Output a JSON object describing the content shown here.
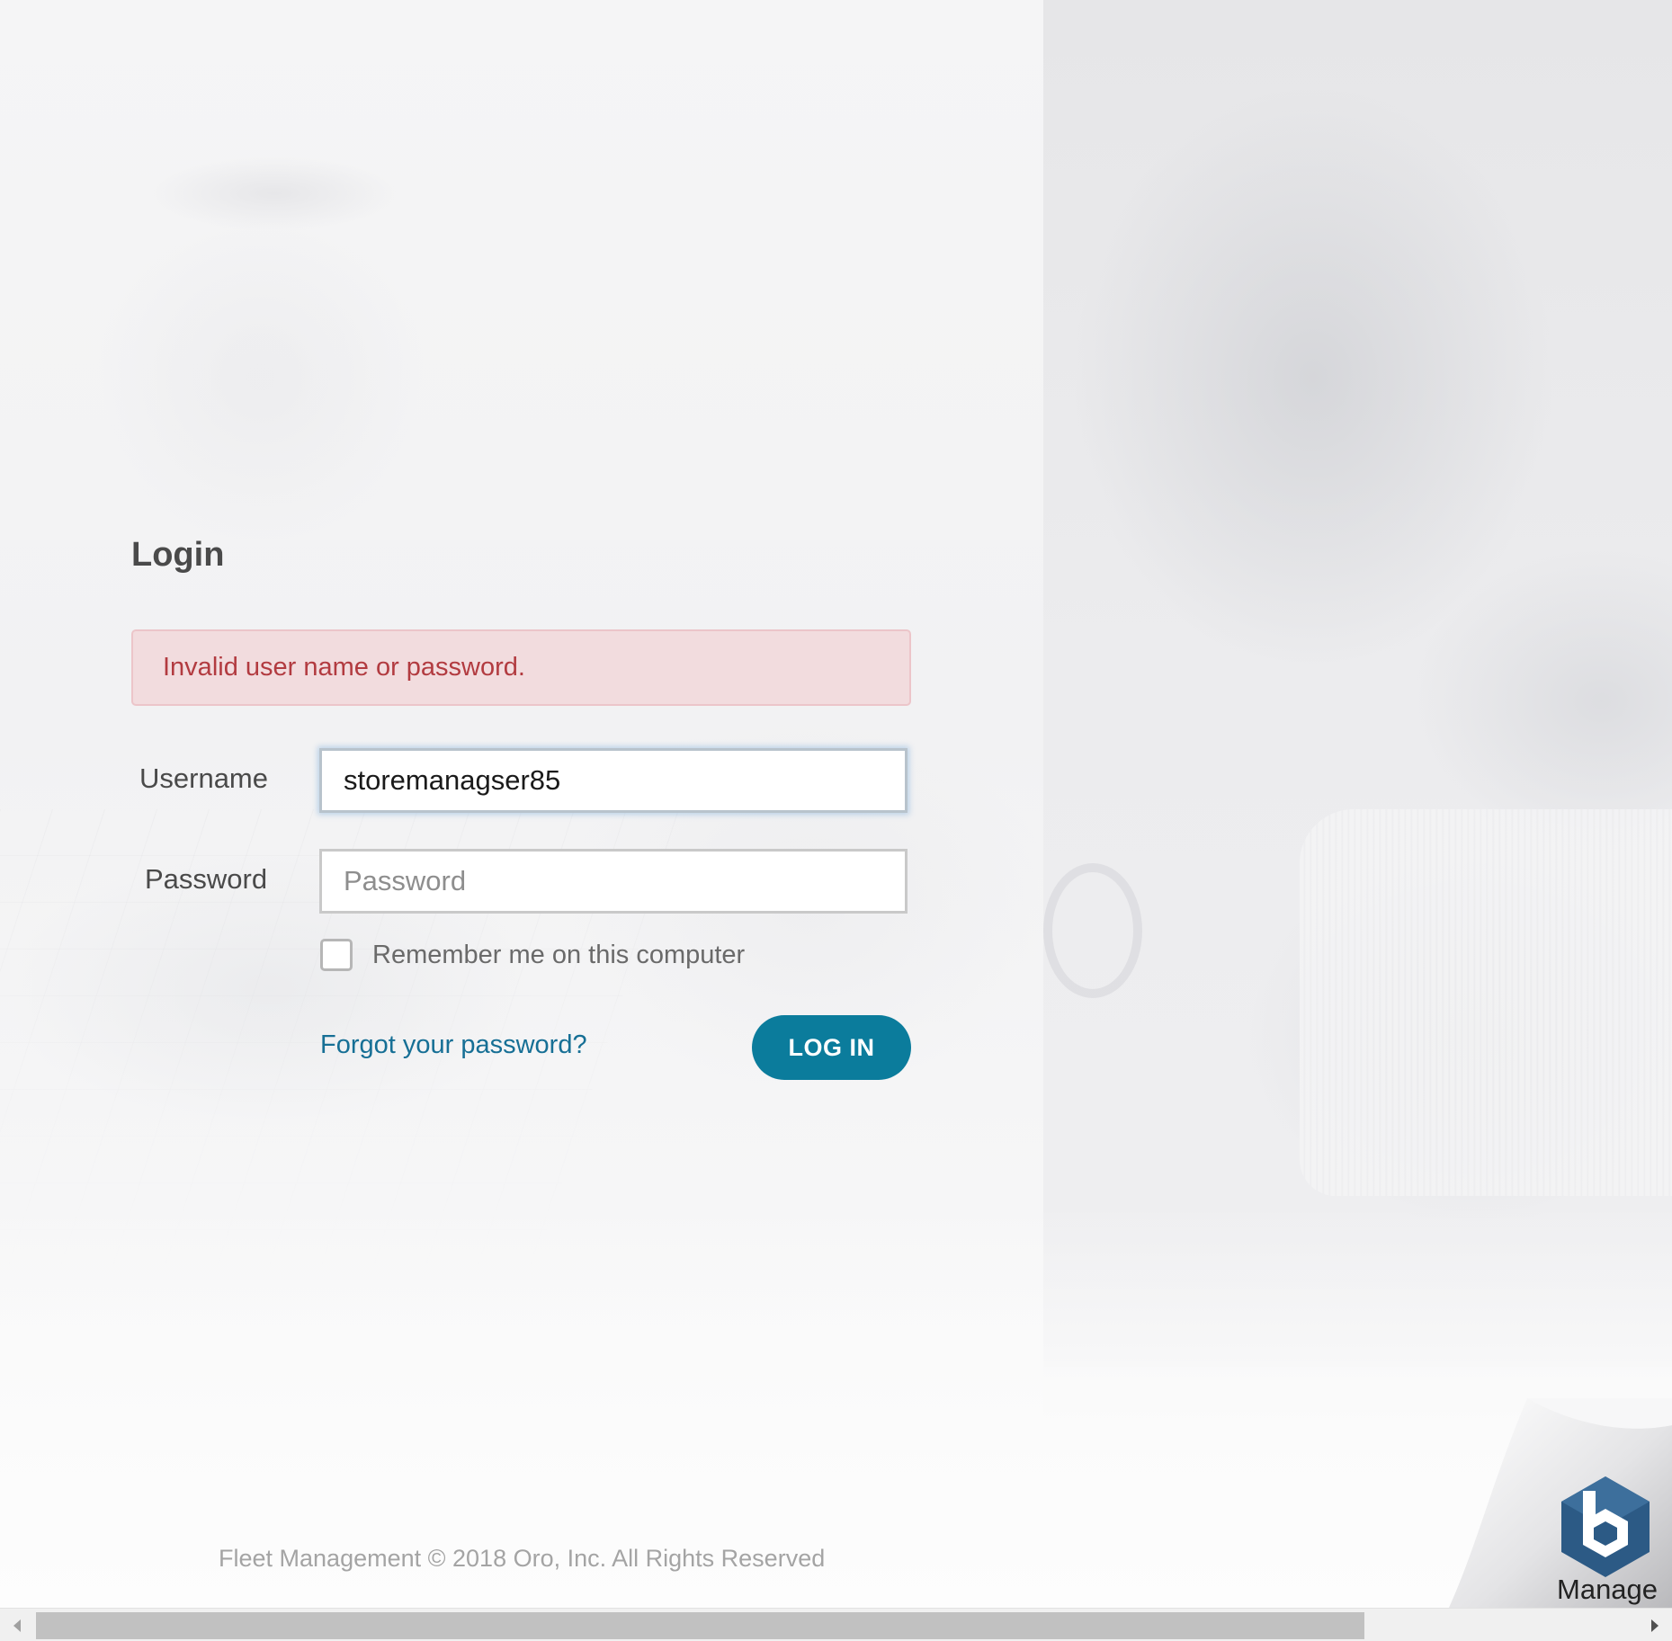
{
  "login": {
    "title": "Login",
    "error": "Invalid user name or password.",
    "username_label": "Username",
    "username_value": "storemanagser85",
    "password_label": "Password",
    "password_placeholder": "Password",
    "remember_label": "Remember me on this computer",
    "remember_checked": false,
    "forgot_link": "Forgot your password?",
    "submit_label": "LOG IN"
  },
  "footer": {
    "text": "Fleet Management © 2018 Oro, Inc. All Rights Reserved"
  },
  "badge": {
    "label": "Manage",
    "icon": "manage-hexagon-icon"
  },
  "scrollbar": {
    "position": 0,
    "visible_fraction": 0.83
  },
  "colors": {
    "accent": "#0b7c9c",
    "link": "#166f95",
    "error_text": "#b23b40",
    "error_bg": "#f2dcde",
    "badge_blue": "#2c5a85"
  }
}
